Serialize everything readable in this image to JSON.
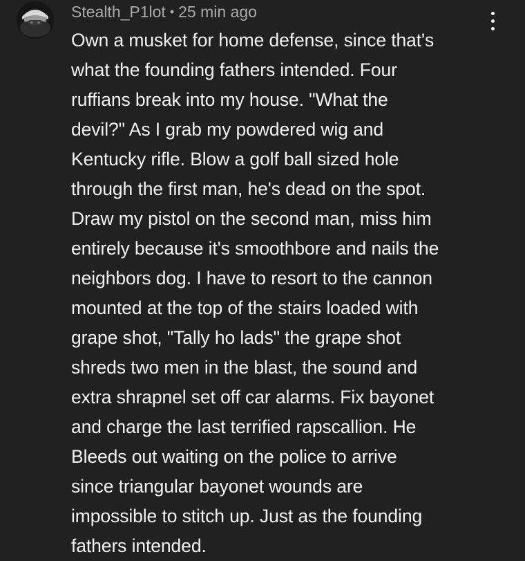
{
  "comment": {
    "author": "Stealth_P1lot",
    "separator": "•",
    "timestamp": "25 min ago",
    "avatar_icon": "avatar-helmet-icon",
    "menu_icon": "more-vertical-icon",
    "lines": [
      "Own a musket for home defense, since that's",
      "what the founding fathers intended. Four",
      "ruffians break into my house. \"What the",
      "devil?\" As I grab my powdered wig and",
      "Kentucky rifle. Blow a golf ball sized hole",
      "through the first man, he's dead on the spot.",
      "Draw my pistol on the second man, miss him",
      "entirely because it's smoothbore and nails the",
      "neighbors dog. I have to resort to the cannon",
      "mounted at the top of the stairs loaded with",
      "grape shot, \"Tally ho lads\" the grape shot",
      "shreds two men in the blast, the sound and",
      "extra shrapnel set off car alarms. Fix bayonet",
      "and charge the last terrified rapscallion. He",
      "Bleeds out waiting on the police to arrive",
      "since triangular bayonet wounds are",
      "impossible to stitch up. Just as the founding",
      "fathers intended."
    ]
  },
  "colors": {
    "background": "#212121",
    "text_primary": "#f1f1f1",
    "text_secondary": "#aaaaaa"
  }
}
